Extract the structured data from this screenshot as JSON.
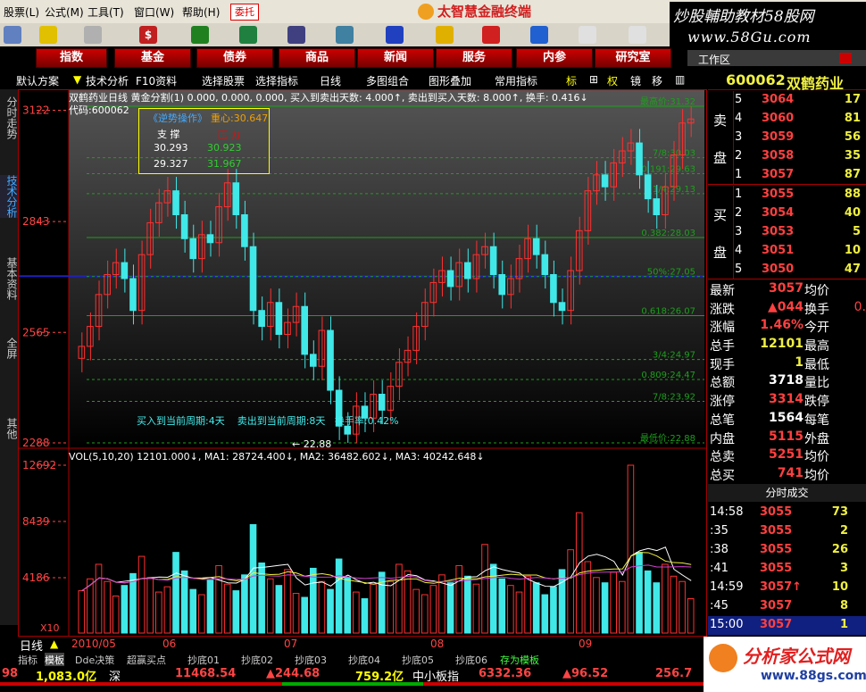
{
  "menu": [
    "股票(L)",
    "公式(M)",
    "工具(T)",
    "窗口(W)",
    "帮助(H)"
  ],
  "menu_weituo": "委托",
  "brand": "太智慧金融终端",
  "watermark": {
    "line1": "炒股輔助教材58股网",
    "line2": "www.58Gu.com"
  },
  "nav": [
    "指数",
    "基金",
    "债券",
    "商品",
    "新闻",
    "服务",
    "内参",
    "研究室"
  ],
  "workarea": "工作区",
  "subbar": [
    "默认方案",
    "技术分析",
    "F10资料",
    "选择股票",
    "选择指标",
    "日线",
    "多图组合",
    "图形叠加",
    "常用指标",
    "标",
    "权",
    "镜",
    "移"
  ],
  "vtabs": [
    "分时走势",
    "技术分析",
    "基本资料",
    "全屏",
    "其他"
  ],
  "chart": {
    "title": "双鹤药业日线 黄金分割(1) 0.000, 0.000, 0.000, 买入到卖出天数: 4.000↑, 卖出到买入天数: 8.000↑, 换手: 0.416↓",
    "code": "代码:600062",
    "box_title": "《逆势操作》",
    "box_center": "重心:30.647",
    "box_headers": [
      "支 撑",
      "压 力"
    ],
    "box_rows": [
      [
        "30.293",
        "30.923"
      ],
      [
        "29.327",
        "31.967"
      ]
    ],
    "yticks": [
      "3122",
      "2843",
      "2565",
      "2288"
    ],
    "fib_labels": [
      {
        "text": "最高价:31.32",
        "y_value": 31.32
      },
      {
        "text": "7/8:30.03",
        "y_value": 30.03
      },
      {
        "text": "0.191:29.63",
        "y_value": 29.63
      },
      {
        "text": "1/4:29.13",
        "y_value": 29.13
      },
      {
        "text": "0.382:28.03",
        "y_value": 28.03
      },
      {
        "text": "50%:27.05",
        "y_value": 27.05
      },
      {
        "text": "0.618:26.07",
        "y_value": 26.07
      },
      {
        "text": "3/4:24.97",
        "y_value": 24.97
      },
      {
        "text": "0.809:24.47",
        "y_value": 24.47
      },
      {
        "text": "7/8:23.92",
        "y_value": 23.92
      },
      {
        "text": "最低价:22.88",
        "y_value": 22.88
      }
    ],
    "note": "买入到当前周期:4天    卖出到当前周期:8天   换手率:0.42%",
    "low_mark": "← 22.88",
    "vol_title": "VOL(5,10,20) 12101.000↓, MA1: 28724.400↓, MA2: 36482.602↓, MA3: 40242.648↓",
    "vol_ticks": [
      "12692",
      "8439",
      "4186"
    ],
    "vol_unit": "X10",
    "dates": [
      "2010/05",
      "06",
      "07",
      "08",
      "09"
    ],
    "period": "日线"
  },
  "chart_data": {
    "type": "candlestick",
    "ylim": [
      22.88,
      31.32
    ],
    "candles_close": [
      25.3,
      25.8,
      26.6,
      27.1,
      27.4,
      27.0,
      26.2,
      27.6,
      28.4,
      28.9,
      29.2,
      28.6,
      28.0,
      27.5,
      28.1,
      27.9,
      28.8,
      29.4,
      28.6,
      27.8,
      26.2,
      25.8,
      26.4,
      25.6,
      25.9,
      26.3,
      25.1,
      24.8,
      25.7,
      24.2,
      23.3,
      23.1,
      23.8,
      23.5,
      24.1,
      23.7,
      24.3,
      24.9,
      25.2,
      25.8,
      26.4,
      26.9,
      27.2,
      26.8,
      27.4,
      27.0,
      27.6,
      27.8,
      27.1,
      26.6,
      27.0,
      27.5,
      28.0,
      27.6,
      27.1,
      26.4,
      26.2,
      27.2,
      28.2,
      29.2,
      29.6,
      29.3,
      29.9,
      30.2,
      30.4,
      29.6,
      29.0,
      28.6,
      29.3,
      30.1,
      30.9,
      31.0
    ],
    "volume": [
      3200,
      4100,
      5200,
      3900,
      2800,
      3600,
      4500,
      5800,
      4200,
      3100,
      3500,
      6100,
      4700,
      3300,
      2900,
      4000,
      5100,
      3700,
      3200,
      4400,
      8200,
      5300,
      4100,
      3600,
      4800,
      3000,
      2700,
      4900,
      3900,
      3300,
      5600,
      4200,
      3100,
      2600,
      3700,
      4600,
      3900,
      5200,
      4700,
      3300,
      2900,
      3600,
      4400,
      3800,
      5100,
      4300,
      3700,
      6700,
      5200,
      4100,
      3600,
      3100,
      4300,
      3800,
      2900,
      3500,
      4800,
      6300,
      9100,
      5400,
      4200,
      3800,
      4600,
      3900,
      12692,
      6100,
      4700,
      3800,
      5200,
      4300,
      3900,
      2600
    ],
    "volume_unit": "X10",
    "x": [
      "2010/05",
      "06",
      "07",
      "08",
      "09"
    ]
  },
  "quote": {
    "code": "600062",
    "name": "双鹤药业",
    "sell_label": [
      "卖",
      "盘"
    ],
    "buy_label": [
      "买",
      "盘"
    ],
    "sell": [
      [
        "5",
        "3064",
        "17"
      ],
      [
        "4",
        "3060",
        "81"
      ],
      [
        "3",
        "3059",
        "56"
      ],
      [
        "2",
        "3058",
        "35"
      ],
      [
        "1",
        "3057",
        "87"
      ]
    ],
    "buy": [
      [
        "1",
        "3055",
        "88"
      ],
      [
        "2",
        "3054",
        "40"
      ],
      [
        "3",
        "3053",
        "5"
      ],
      [
        "4",
        "3051",
        "10"
      ],
      [
        "5",
        "3050",
        "47"
      ]
    ],
    "stats": [
      [
        "最新",
        "3057",
        "均价",
        ""
      ],
      [
        "涨跌",
        "▲044",
        "换手",
        "0."
      ],
      [
        "涨幅",
        "1.46%",
        "今开",
        ""
      ],
      [
        "总手",
        "12101",
        "最高",
        ""
      ],
      [
        "现手",
        "1",
        "最低",
        ""
      ],
      [
        "总额",
        "3718",
        "量比",
        ""
      ],
      [
        "涨停",
        "3314",
        "跌停",
        ""
      ],
      [
        "总笔",
        "1564",
        "每笔",
        ""
      ],
      [
        "内盘",
        "5115",
        "外盘",
        ""
      ],
      [
        "总卖",
        "5251",
        "均价",
        ""
      ],
      [
        "总买",
        "741",
        "均价",
        ""
      ]
    ],
    "ticks_title": "分时成交",
    "ticks": [
      [
        "14:58",
        "3055",
        "73"
      ],
      [
        ":35",
        "3055",
        "2"
      ],
      [
        ":38",
        "3055",
        "26"
      ],
      [
        ":41",
        "3055",
        "3"
      ],
      [
        "14:59",
        "3057↑",
        "10"
      ],
      [
        ":45",
        "3057",
        "8"
      ],
      [
        "15:00",
        "3057",
        "1"
      ]
    ]
  },
  "bottom_tabs": [
    "指标",
    "模板",
    "Dde决策",
    "超赢买点",
    "抄底01",
    "抄底02",
    "抄底03",
    "抄底04",
    "抄底05",
    "抄底06",
    "存为模板"
  ],
  "status": [
    "98",
    "1,083.0亿",
    "深",
    "11468.54",
    "▲244.68",
    "759.2亿",
    "中小板指",
    "6332.36",
    "▲96.52",
    "256.7"
  ],
  "logo": {
    "text": "分析家公式网",
    "url": "www.88gs.com"
  }
}
